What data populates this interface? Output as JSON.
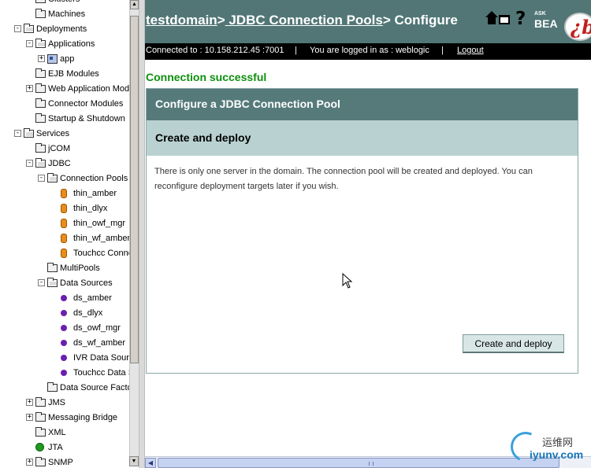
{
  "tree": {
    "items": [
      {
        "label": "Clusters",
        "depth": 1,
        "toggle": "",
        "icon": "folder-icon"
      },
      {
        "label": "Machines",
        "depth": 1,
        "toggle": "",
        "icon": "folder-icon"
      },
      {
        "label": "Deployments",
        "depth": 0,
        "toggle": "-",
        "icon": "folder-open-icon"
      },
      {
        "label": "Applications",
        "depth": 1,
        "toggle": "-",
        "icon": "folder-open-icon"
      },
      {
        "label": "app",
        "depth": 2,
        "toggle": "+",
        "icon": "application-icon"
      },
      {
        "label": "EJB Modules",
        "depth": 1,
        "toggle": "",
        "icon": "folder-icon"
      },
      {
        "label": "Web Application Modules",
        "depth": 1,
        "toggle": "+",
        "icon": "folder-icon"
      },
      {
        "label": "Connector Modules",
        "depth": 1,
        "toggle": "",
        "icon": "folder-icon"
      },
      {
        "label": "Startup & Shutdown",
        "depth": 1,
        "toggle": "",
        "icon": "folder-icon"
      },
      {
        "label": "Services",
        "depth": 0,
        "toggle": "-",
        "icon": "folder-open-icon"
      },
      {
        "label": "jCOM",
        "depth": 1,
        "toggle": "",
        "icon": "folder-icon"
      },
      {
        "label": "JDBC",
        "depth": 1,
        "toggle": "-",
        "icon": "folder-open-icon"
      },
      {
        "label": "Connection Pools",
        "depth": 2,
        "toggle": "-",
        "icon": "folder-open-icon"
      },
      {
        "label": "thin_amber",
        "depth": 3,
        "toggle": "",
        "icon": "database-icon"
      },
      {
        "label": "thin_dlyx",
        "depth": 3,
        "toggle": "",
        "icon": "database-icon"
      },
      {
        "label": "thin_owf_mgr",
        "depth": 3,
        "toggle": "",
        "icon": "database-icon"
      },
      {
        "label": "thin_wf_amber",
        "depth": 3,
        "toggle": "",
        "icon": "database-icon"
      },
      {
        "label": "Touchcc Connectio",
        "depth": 3,
        "toggle": "",
        "icon": "database-icon"
      },
      {
        "label": "MultiPools",
        "depth": 2,
        "toggle": "",
        "icon": "folder-icon"
      },
      {
        "label": "Data Sources",
        "depth": 2,
        "toggle": "-",
        "icon": "folder-open-icon"
      },
      {
        "label": "ds_amber",
        "depth": 3,
        "toggle": "",
        "icon": "datasource-icon"
      },
      {
        "label": "ds_dlyx",
        "depth": 3,
        "toggle": "",
        "icon": "datasource-icon"
      },
      {
        "label": "ds_owf_mgr",
        "depth": 3,
        "toggle": "",
        "icon": "datasource-icon"
      },
      {
        "label": "ds_wf_amber",
        "depth": 3,
        "toggle": "",
        "icon": "datasource-icon"
      },
      {
        "label": "IVR Data Source",
        "depth": 3,
        "toggle": "",
        "icon": "datasource-icon"
      },
      {
        "label": "Touchcc Data Sour",
        "depth": 3,
        "toggle": "",
        "icon": "datasource-icon"
      },
      {
        "label": "Data Source Factories",
        "depth": 2,
        "toggle": "",
        "icon": "folder-icon"
      },
      {
        "label": "JMS",
        "depth": 1,
        "toggle": "+",
        "icon": "folder-icon"
      },
      {
        "label": "Messaging Bridge",
        "depth": 1,
        "toggle": "+",
        "icon": "folder-icon"
      },
      {
        "label": "XML",
        "depth": 1,
        "toggle": "",
        "icon": "folder-icon"
      },
      {
        "label": "JTA",
        "depth": 1,
        "toggle": "",
        "icon": "jta-icon"
      },
      {
        "label": "SNMP",
        "depth": 1,
        "toggle": "+",
        "icon": "folder-icon"
      }
    ]
  },
  "header": {
    "crumb1": "testdomain",
    "sep1": ">",
    "crumb2": " JDBC Connection Pools",
    "sep2": ">",
    "current": " Configure",
    "ask_label": "ASK",
    "bea_label": "BEA",
    "help_glyph": "?"
  },
  "status": {
    "connected_label": "Connected to : ",
    "connected_value": "10.158.212.45 :7001",
    "divider": "|",
    "logged_label": "You are logged in as : ",
    "logged_value": "weblogic",
    "logout": "Logout"
  },
  "message": "Connection successful",
  "panel": {
    "title": "Configure a JDBC Connection Pool",
    "subtitle": "Create and deploy",
    "body": "There is only one server in the domain. The connection pool will be created and deployed. You can reconfigure deployment targets later if you wish.",
    "button": "Create and deploy"
  },
  "watermark": {
    "cn": "运维网",
    "site": "iyunv.com"
  },
  "colors": {
    "header_bg": "#527676",
    "panel_title_bg": "#567a7a",
    "panel_sub_bg": "#b9d1d1",
    "success_green": "#0d8f0d"
  }
}
